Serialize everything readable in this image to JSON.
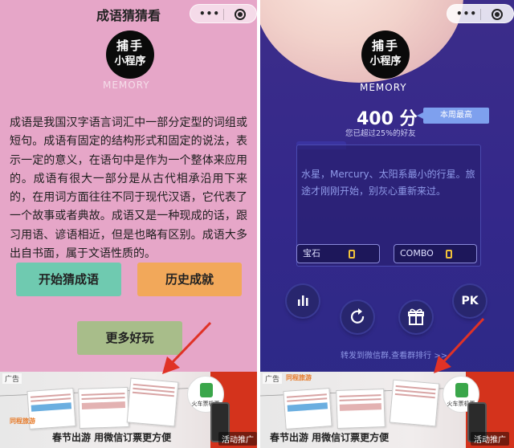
{
  "left": {
    "title": "成语猜猜看",
    "logo": {
      "line1": "捕手",
      "line2": "小程序",
      "subtitle": "MEMORY"
    },
    "description": "成语是我国汉字语言词汇中一部分定型的词组或短句。成语有固定的结构形式和固定的说法，表示一定的意义，在语句中是作为一个整体来应用的。成语有很大一部分是从古代相承沿用下来的，在用词方面往往不同于现代汉语，它代表了一个故事或者典故。成语又是一种现成的话，跟习用语、谚语相近，但是也略有区别。成语大多出自书面，属于文语性质的。",
    "buttons": {
      "start": "开始猜成语",
      "history": "历史成就",
      "more": "更多好玩"
    },
    "ad": {
      "tag": "广告",
      "brand": "同程旅游",
      "caption": "春节出游  用微信订票更方便",
      "circle_label": "火车票机票",
      "promo": "活动推广"
    }
  },
  "right": {
    "logo": {
      "line1": "捕手",
      "line2": "小程序",
      "subtitle": "MEMORY"
    },
    "score": "400 分",
    "score_badge": "本周最高",
    "score_sub": "您已超过25%的好友",
    "message": "水星，Mercury、太阳系最小的行星。旅途才刚刚开始，别灰心重新来过。",
    "stats": {
      "gem_label": "宝石",
      "gem_value": "0",
      "combo_label": "COMBO",
      "combo_value": "0"
    },
    "controls": {
      "rank_icon": "bar-chart-icon",
      "restart_icon": "refresh-icon",
      "gift_icon": "gift-icon",
      "pk_label": "PK"
    },
    "share_text": "转发到微信群,查看群排行 >>",
    "ad": {
      "tag": "广告",
      "brand": "同程旅游",
      "caption": "春节出游  用微信订票更方便",
      "circle_label": "火车票机票",
      "promo": "活动推广"
    }
  },
  "colors": {
    "left_bg": "#e6a6c8",
    "start_btn": "#6fcab0",
    "history_btn": "#f2a85a",
    "more_btn": "#a8bd8a",
    "right_bg": "#34288a",
    "badge": "#7ea0ee",
    "annotation_arrow": "#e03226"
  }
}
